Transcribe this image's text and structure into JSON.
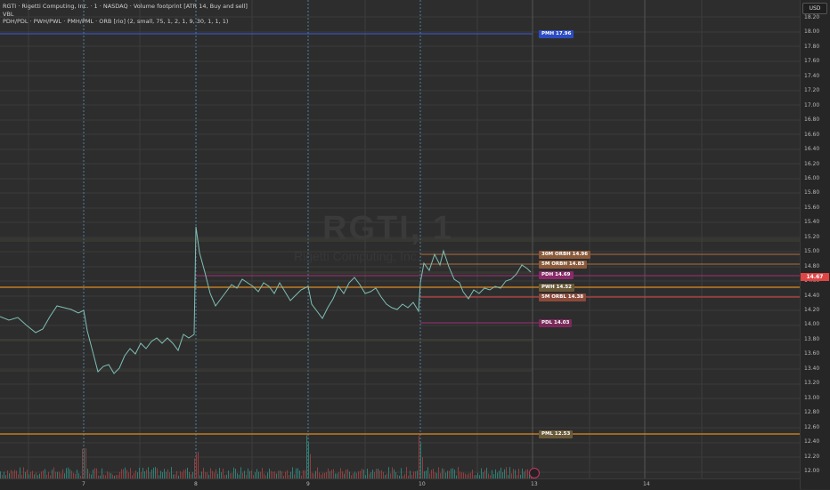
{
  "legend": {
    "title": "RGTI · Rigetti Computing, Inc. · 1 · NASDAQ · Volume footprint [ATR 14, Buy and sell]",
    "vbl": "VBL",
    "indicator": "PDH/PDL · PWH/PWL · PMH/PML · ORB [rio] (2, small, 75, 1, 2, 1, 9, 30, 1, 1, 1)"
  },
  "watermark": {
    "symbol": "RGTI, 1",
    "name": "Rigetti Computing, Inc."
  },
  "axis": {
    "currency": "USD",
    "price_ticks": [
      "18.20",
      "18.00",
      "17.80",
      "17.60",
      "17.40",
      "17.20",
      "17.00",
      "16.80",
      "16.60",
      "16.40",
      "16.20",
      "16.00",
      "15.80",
      "15.60",
      "15.40",
      "15.20",
      "15.00",
      "14.80",
      "14.60",
      "14.40",
      "14.20",
      "14.00",
      "13.80",
      "13.60",
      "13.40",
      "13.20",
      "13.00",
      "12.80",
      "12.60",
      "12.40",
      "12.20",
      "12.00"
    ],
    "time_ticks": [
      "7",
      "8",
      "9",
      "10",
      "13",
      "14"
    ],
    "current_price": "14.67"
  },
  "levels": {
    "pmh": "PMH  17.96",
    "orbh30": "30M ORBH  14.96",
    "orbh5": "5M ORBH  14.83",
    "pdh": "PDH  14.69",
    "pwh": "PWH  14.52",
    "orbl": "5M ORBL  14.38",
    "pdl": "PDL  14.03",
    "pml": "PML  12.53"
  },
  "colors": {
    "pmh": "#3b5bdb",
    "orb": "#b07040",
    "pdh": "#a0307a",
    "pwh": "#e08a20",
    "pml": "#e08a20",
    "up": "#26a69a",
    "down": "#ef5350"
  }
}
